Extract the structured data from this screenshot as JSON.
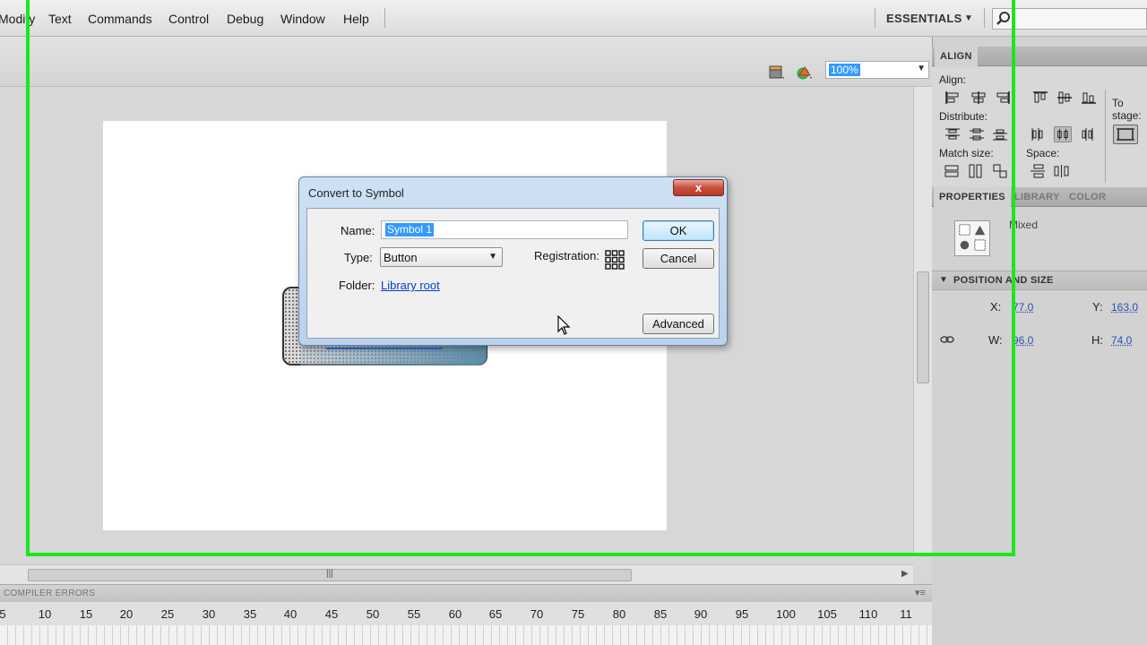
{
  "menubar": {
    "items": [
      "Modify",
      "Text",
      "Commands",
      "Control",
      "Debug",
      "Window",
      "Help"
    ],
    "workspace": "ESSENTIALS"
  },
  "edit_bar": {
    "zoom": "100%"
  },
  "dialog": {
    "title": "Convert to Symbol",
    "close_label": "x",
    "name_label": "Name:",
    "name_value": "Symbol 1",
    "type_label": "Type:",
    "type_value": "Button",
    "folder_label": "Folder:",
    "folder_value": "Library root",
    "registration_label": "Registration:",
    "ok_label": "OK",
    "cancel_label": "Cancel",
    "advanced_label": "Advanced"
  },
  "align_panel": {
    "tab": "ALIGN",
    "align_label": "Align:",
    "distribute_label": "Distribute:",
    "match_size_label": "Match size:",
    "space_label": "Space:",
    "to_stage_label": "To stage:"
  },
  "properties_panel": {
    "tabs": [
      "PROPERTIES",
      "LIBRARY",
      "COLOR"
    ],
    "mixed_label": "Mixed",
    "section_title": "POSITION AND SIZE",
    "x_label": "X:",
    "x_value": "77.0",
    "y_label": "Y:",
    "y_value": "163.0",
    "w_label": "W:",
    "w_value": "96.0",
    "h_label": "H:",
    "h_value": "74.0"
  },
  "timeline": {
    "title": "COMPILER ERRORS",
    "ticks": [
      "5",
      "10",
      "15",
      "20",
      "25",
      "30",
      "35",
      "40",
      "45",
      "50",
      "55",
      "60",
      "65",
      "70",
      "75",
      "80",
      "85",
      "90",
      "95",
      "100",
      "105",
      "110",
      "11"
    ]
  },
  "colors": {
    "overlay_frame": "#1ee61e",
    "selection": "#3399ff",
    "link": "#0b3bc7"
  }
}
